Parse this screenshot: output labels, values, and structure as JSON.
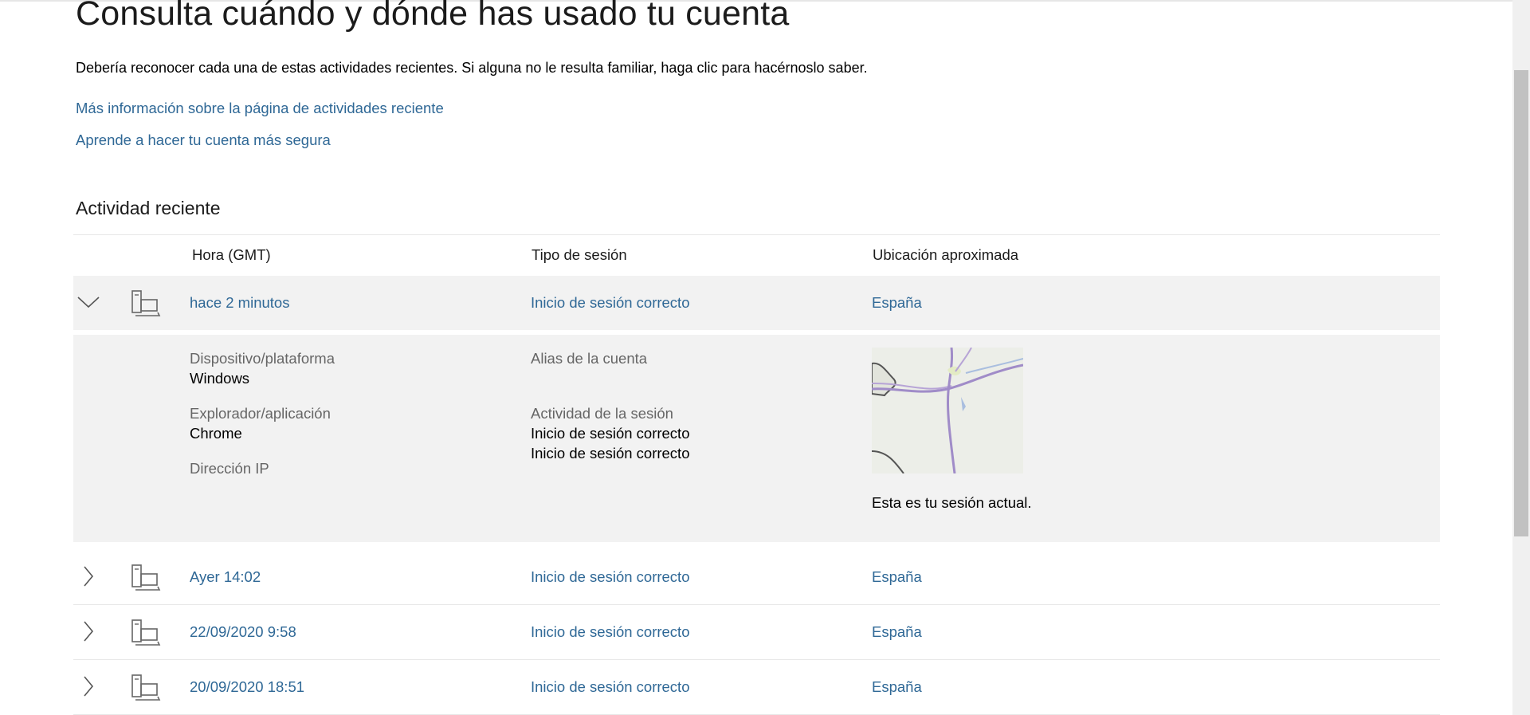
{
  "header": {
    "title": "Consulta cuándo y dónde has usado tu cuenta",
    "intro": "Debería reconocer cada una de estas actividades recientes. Si alguna no le resulta familiar, haga clic para hacérnoslo saber.",
    "links": [
      "Más información sobre la página de actividades reciente",
      "Aprende a hacer tu cuenta más segura"
    ]
  },
  "activity": {
    "section_title": "Actividad reciente",
    "columns": {
      "time": "Hora (GMT)",
      "type": "Tipo de sesión",
      "location": "Ubicación aproximada"
    },
    "rows": [
      {
        "time": "hace 2 minutos",
        "type": "Inicio de sesión correcto",
        "location": "España",
        "expanded": true,
        "details": {
          "device_label": "Dispositivo/plataforma",
          "device_value": "Windows",
          "browser_label": "Explorador/aplicación",
          "browser_value": "Chrome",
          "ip_label": "Dirección IP",
          "alias_label": "Alias de la cuenta",
          "session_activity_label": "Actividad de la sesión",
          "session_activity_values": [
            "Inicio de sesión correcto",
            "Inicio de sesión correcto"
          ],
          "current_session_note": "Esta es tu sesión actual."
        }
      },
      {
        "time": "Ayer 14:02",
        "type": "Inicio de sesión correcto",
        "location": "España",
        "expanded": false
      },
      {
        "time": "22/09/2020 9:58",
        "type": "Inicio de sesión correcto",
        "location": "España",
        "expanded": false
      },
      {
        "time": "20/09/2020 18:51",
        "type": "Inicio de sesión correcto",
        "location": "España",
        "expanded": false
      }
    ]
  },
  "icons": {
    "row_expanded": "chevron-down-icon",
    "row_collapsed": "chevron-right-icon",
    "device": "device-pc-icon"
  },
  "colors": {
    "link": "#2f6896",
    "row_highlight": "#f2f2f2",
    "muted_label": "#666666"
  }
}
